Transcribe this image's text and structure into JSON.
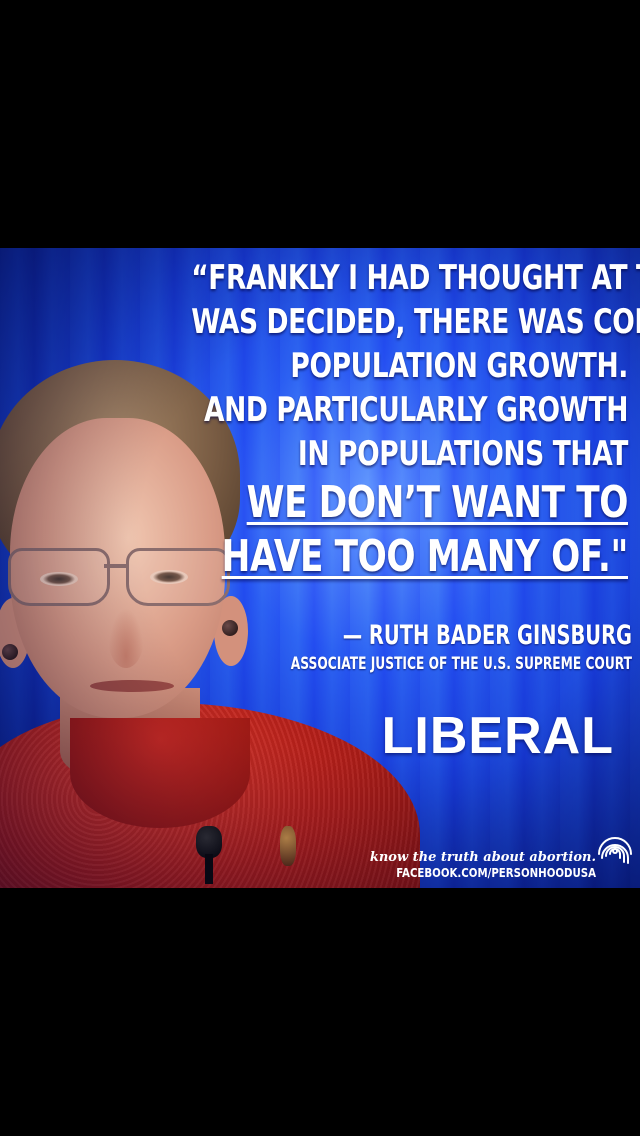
{
  "meme": {
    "quote_lines": [
      "“FRANKLY I HAD THOUGHT AT THE TIME ROE",
      "WAS DECIDED, THERE WAS CONCERN ABOUT",
      "POPULATION GROWTH.",
      "AND PARTICULARLY GROWTH",
      "IN POPULATIONS THAT",
      "WE DON’T WANT TO",
      "HAVE TOO MANY OF.\""
    ],
    "attribution_name": "— RUTH BADER GINSBURG",
    "attribution_title": "ASSOCIATE JUSTICE OF THE U.S. SUPREME COURT",
    "label": "LIBERAL",
    "tagline": "know the truth about abortion.",
    "facebook": "FACEBOOK.COM/PERSONHOODUSA",
    "logo_icon": "fingerprint-icon"
  },
  "colors": {
    "background_blue": "#1a43d8",
    "jacket_red": "#b8201a",
    "text_white": "#ffffff",
    "letterbox_black": "#000000"
  }
}
